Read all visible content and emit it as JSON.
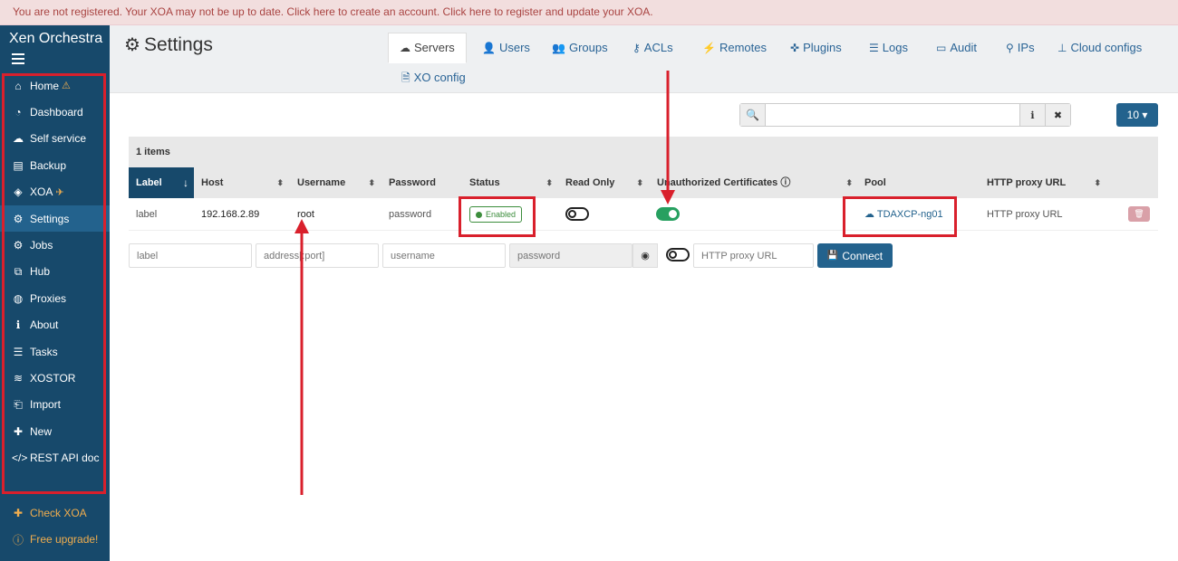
{
  "banner": "You are not registered. Your XOA may not be up to date. Click here to create an account. Click here to register and update your XOA.",
  "sidebar": {
    "brand": "Xen Orchestra",
    "items": [
      {
        "label": "Home",
        "icon": "home-icon"
      },
      {
        "label": "Dashboard",
        "icon": "dashboard-icon"
      },
      {
        "label": "Self service",
        "icon": "cloud-icon"
      },
      {
        "label": "Backup",
        "icon": "archive-icon"
      },
      {
        "label": "XOA",
        "icon": "cube-icon"
      },
      {
        "label": "Settings",
        "icon": "gear-icon"
      },
      {
        "label": "Jobs",
        "icon": "gears-icon"
      },
      {
        "label": "Hub",
        "icon": "cubes-icon"
      },
      {
        "label": "Proxies",
        "icon": "globe-icon"
      },
      {
        "label": "About",
        "icon": "info-icon"
      },
      {
        "label": "Tasks",
        "icon": "tasks-icon"
      },
      {
        "label": "XOSTOR",
        "icon": "database-icon"
      },
      {
        "label": "Import",
        "icon": "file-import-icon"
      },
      {
        "label": "New",
        "icon": "plus-icon"
      },
      {
        "label": "REST API doc",
        "icon": "code-icon"
      }
    ],
    "extra": [
      {
        "label": "Check XOA",
        "icon": "medkit-icon"
      },
      {
        "label": "Free upgrade!",
        "icon": "info-circle-icon"
      }
    ]
  },
  "header": {
    "title": "Settings",
    "tabs": [
      "Servers",
      "Users",
      "Groups",
      "ACLs",
      "Remotes",
      "Plugins",
      "Logs",
      "Audit",
      "IPs",
      "Cloud configs",
      "XO config"
    ]
  },
  "toolbar": {
    "search_value": "",
    "per_page": "10"
  },
  "table": {
    "count": "1 items",
    "columns": [
      "Label",
      "Host",
      "Username",
      "Password",
      "Status",
      "Read Only",
      "Unauthorized Certificates",
      "Pool",
      "HTTP proxy URL"
    ],
    "rows": [
      {
        "label": "label",
        "host": "192.168.2.89",
        "username": "root",
        "password": "password",
        "status": "Enabled",
        "read_only": false,
        "unauthorized_certificates": true,
        "pool": "TDAXCP-ng01",
        "http_proxy": "HTTP proxy URL"
      }
    ]
  },
  "new_server_form": {
    "label_placeholder": "label",
    "address_placeholder": "address[:port]",
    "username_placeholder": "username",
    "password_placeholder": "password",
    "proxy_placeholder": "HTTP proxy URL",
    "connect_label": "Connect"
  },
  "colors": {
    "sidebar_bg": "#17496b",
    "accent": "#23628d",
    "highlight": "#d9202c",
    "toggle_on": "#27a060"
  }
}
